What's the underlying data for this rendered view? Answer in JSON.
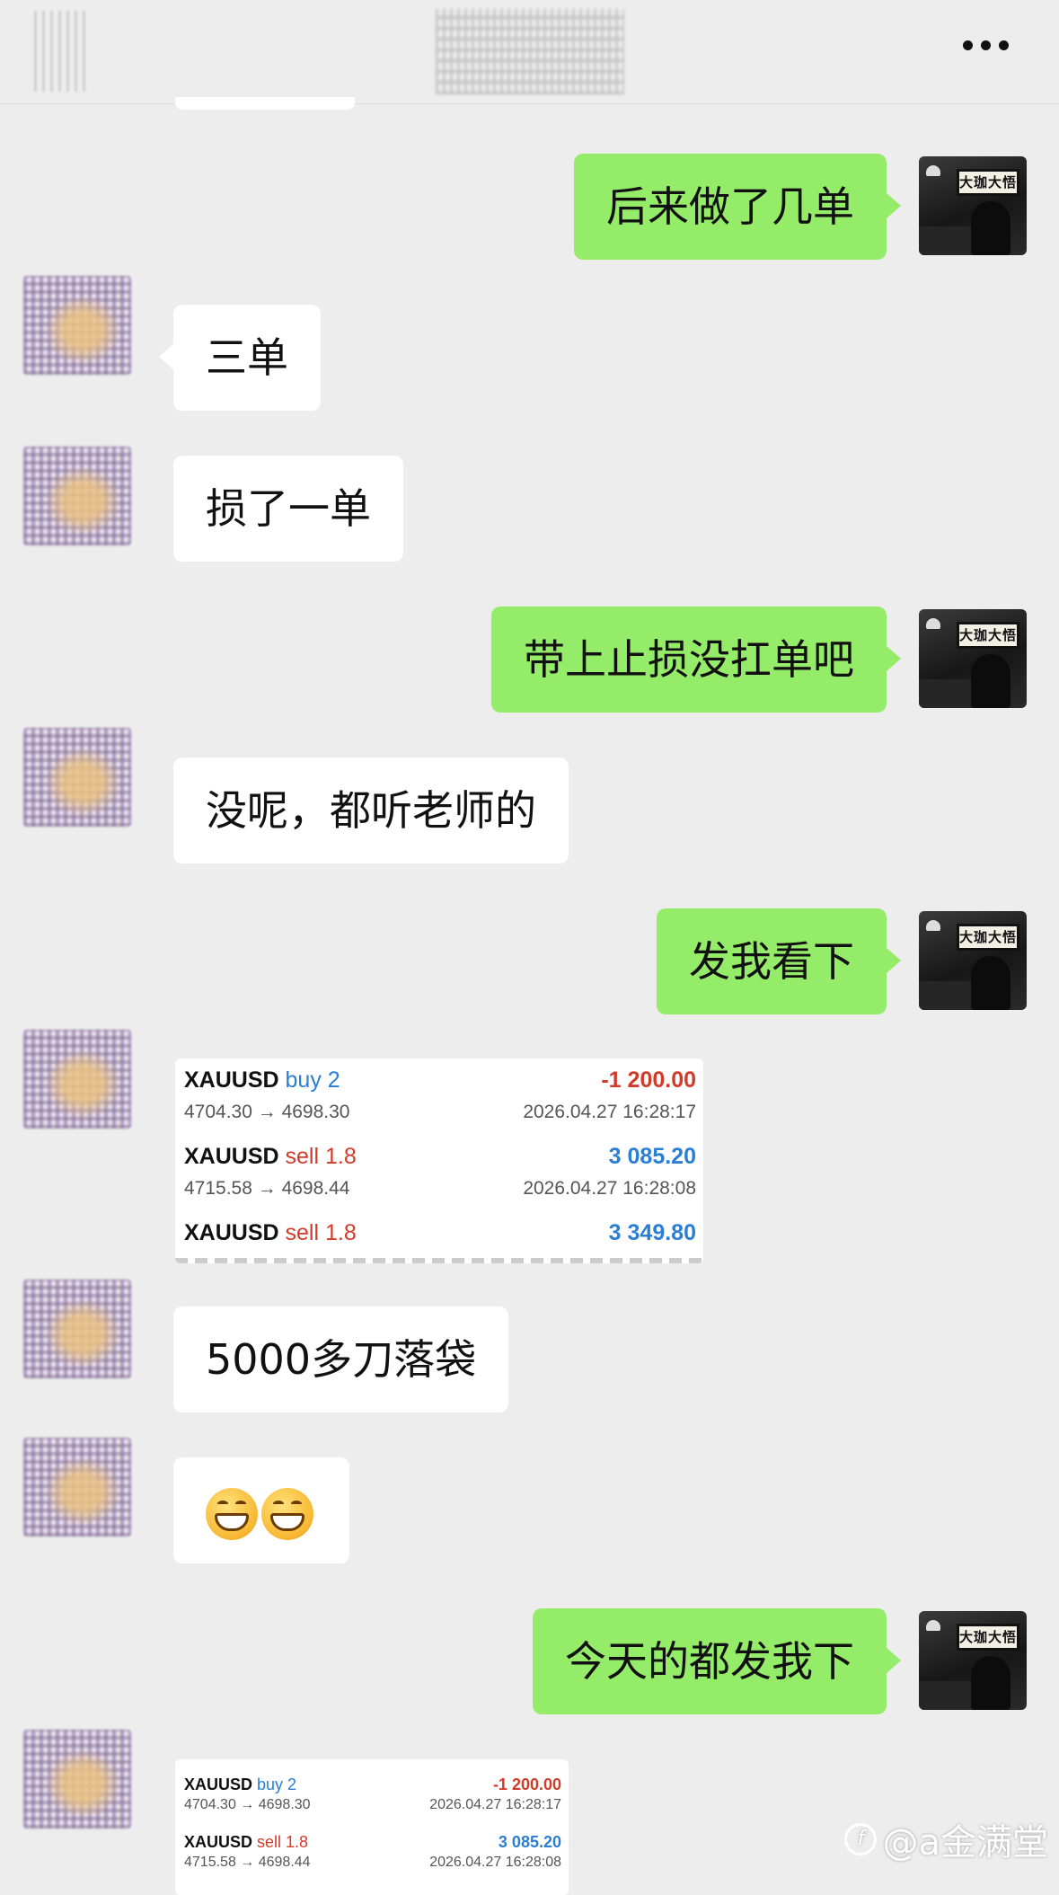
{
  "header": {
    "more_icon": "more-dots-icon"
  },
  "messages": [
    {
      "sender": "self",
      "text": "后来做了几单"
    },
    {
      "sender": "other",
      "text": "三单"
    },
    {
      "sender": "other",
      "text": "损了一单"
    },
    {
      "sender": "self",
      "text": "带上止损没扛单吧"
    },
    {
      "sender": "other",
      "text": "没呢，都听老师的"
    },
    {
      "sender": "self",
      "text": "发我看下"
    },
    {
      "sender": "other",
      "type": "image",
      "trades": [
        {
          "symbol": "XAUUSD",
          "side": "buy 2",
          "side_type": "buy",
          "pnl": "-1 200.00",
          "prices": "4704.30 → 4698.30",
          "time": "2026.04.27 16:28:17"
        },
        {
          "sender_note": "",
          "symbol": "XAUUSD",
          "side": "sell 1.8",
          "side_type": "sell",
          "pnl": "3 085.20",
          "prices": "4715.58 → 4698.44",
          "time": "2026.04.27 16:28:08"
        },
        {
          "symbol": "XAUUSD",
          "side": "sell 1.8",
          "side_type": "sell",
          "pnl": "3 349.80"
        }
      ]
    },
    {
      "sender": "other",
      "text": "5000多刀落袋"
    },
    {
      "sender": "other",
      "type": "emoji",
      "emoji": "😁😁"
    },
    {
      "sender": "self",
      "text": "今天的都发我下"
    },
    {
      "sender": "other",
      "type": "image",
      "trades": [
        {
          "symbol": "XAUUSD",
          "side": "buy 2",
          "side_type": "buy",
          "pnl": "-1 200.00",
          "prices": "4704.30 → 4698.30",
          "time": "2026.04.27 16:28:17"
        },
        {
          "symbol": "XAUUSD",
          "side": "sell 1.8",
          "side_type": "sell",
          "pnl": "3 085.20",
          "prices": "4715.58 → 4698.44",
          "time": "2026.04.27 16:28:08"
        }
      ]
    }
  ],
  "self_avatar": {
    "sign_text": "大珈大悟"
  },
  "watermark": {
    "text": "@a金满堂",
    "logo": "f"
  },
  "colors": {
    "background": "#ededed",
    "self_bubble": "#95ec69",
    "other_bubble": "#ffffff",
    "buy": "#2a7fd4",
    "sell": "#d23b2a"
  }
}
